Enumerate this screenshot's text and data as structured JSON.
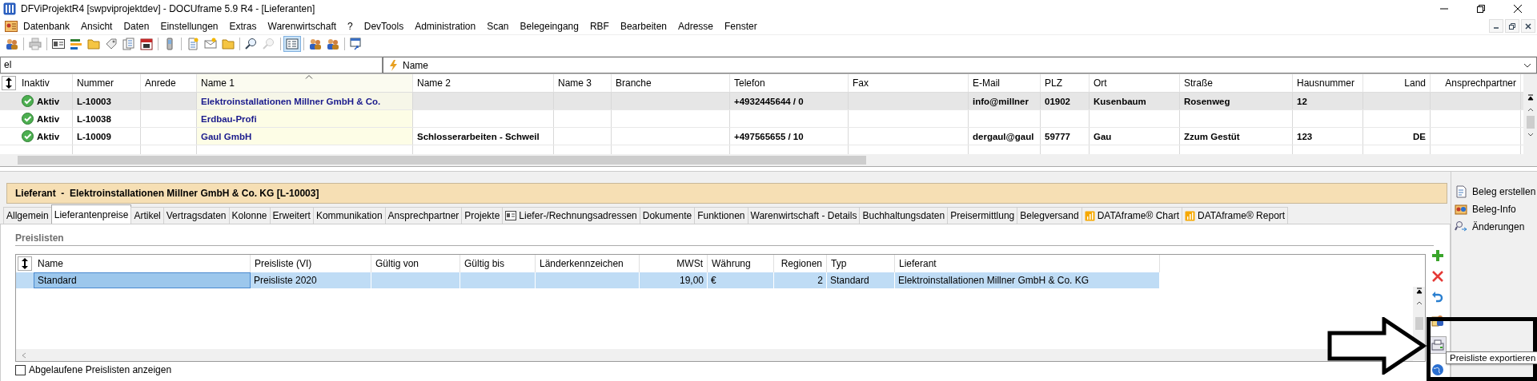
{
  "window": {
    "title": "DFViProjektR4 [swpviprojektdev] - DOCUframe 5.9 R4 - [Lieferanten]"
  },
  "menu": [
    "Datenbank",
    "Ansicht",
    "Daten",
    "Einstellungen",
    "Extras",
    "Warenwirtschaft",
    "?",
    "DevTools",
    "Administration",
    "Scan",
    "Belegeingang",
    "RBF",
    "Bearbeiten",
    "Adresse",
    "Fenster"
  ],
  "filter": {
    "value": "el",
    "field": "Name"
  },
  "grid": {
    "columns": [
      {
        "label": "Inaktiv",
        "sorted": false
      },
      {
        "label": "Nummer",
        "sorted": false
      },
      {
        "label": "Anrede",
        "sorted": false
      },
      {
        "label": "Name 1",
        "sorted": true
      },
      {
        "label": "Name 2",
        "sorted": false
      },
      {
        "label": "Name 3",
        "sorted": false
      },
      {
        "label": "Branche",
        "sorted": false
      },
      {
        "label": "Telefon",
        "sorted": false
      },
      {
        "label": "Fax",
        "sorted": false
      },
      {
        "label": "E-Mail",
        "sorted": false
      },
      {
        "label": "PLZ",
        "sorted": false
      },
      {
        "label": "Ort",
        "sorted": false
      },
      {
        "label": "Straße",
        "sorted": false
      },
      {
        "label": "Hausnummer",
        "sorted": false
      },
      {
        "label": "Land",
        "sorted": false
      },
      {
        "label": "Ansprechpartner",
        "sorted": false
      }
    ],
    "rows": [
      {
        "selected": true,
        "cells": [
          "Aktiv",
          "L-10003",
          "",
          "Elektroinstallationen Millner GmbH & Co.",
          "",
          "",
          "",
          "+4932445644 / 0",
          "",
          "info@millner",
          "01902",
          "Kusenbaum",
          "Rosenweg",
          "12",
          "",
          ""
        ]
      },
      {
        "selected": false,
        "cells": [
          "Aktiv",
          "L-10038",
          "",
          "Erdbau-Profi",
          "",
          "",
          "",
          "",
          "",
          "",
          "",
          "",
          "",
          "",
          "",
          ""
        ]
      },
      {
        "selected": false,
        "cells": [
          "Aktiv",
          "L-10009",
          "",
          "Gaul GmbH",
          "Schlosserarbeiten - Schweil",
          "",
          "",
          "+497565655 / 10",
          "",
          "dergaul@gaul",
          "59777",
          "Gau",
          "Zzum Gestüt",
          "123",
          "DE",
          ""
        ]
      }
    ]
  },
  "detail": {
    "header": "Lieferant  -  Elektroinstallationen Millner GmbH & Co. KG [L-10003]",
    "tabs": [
      {
        "label": "Allgemein",
        "selected": false,
        "kind": "plain"
      },
      {
        "label": "Lieferantenpreise",
        "selected": true,
        "kind": "plain"
      },
      {
        "label": "Artikel",
        "selected": false,
        "kind": "plain"
      },
      {
        "label": "Vertragsdaten",
        "selected": false,
        "kind": "plain"
      },
      {
        "label": "Kolonne",
        "selected": false,
        "kind": "plain"
      },
      {
        "label": "Erweitert",
        "selected": false,
        "kind": "plain"
      },
      {
        "label": "Kommunikation",
        "selected": false,
        "kind": "plain"
      },
      {
        "label": "Ansprechpartner",
        "selected": false,
        "kind": "plain"
      },
      {
        "label": "Projekte",
        "selected": false,
        "kind": "plain"
      },
      {
        "label": "Liefer-/Rechnungsadressen",
        "selected": false,
        "kind": "card"
      },
      {
        "label": "Dokumente",
        "selected": false,
        "kind": "plain"
      },
      {
        "label": "Funktionen",
        "selected": false,
        "kind": "plain"
      },
      {
        "label": "Warenwirtschaft - Details",
        "selected": false,
        "kind": "plain"
      },
      {
        "label": "Buchhaltungsdaten",
        "selected": false,
        "kind": "plain"
      },
      {
        "label": "Preisermittlung",
        "selected": false,
        "kind": "plain"
      },
      {
        "label": "Belegversand",
        "selected": false,
        "kind": "plain"
      },
      {
        "label": "DATAframe® Chart",
        "selected": false,
        "kind": "chart"
      },
      {
        "label": "DATAframe® Report",
        "selected": false,
        "kind": "chart"
      }
    ],
    "section": "Preislisten",
    "price_grid": {
      "columns": [
        "Name",
        "Preisliste (VI)",
        "Gültig von",
        "Gültig bis",
        "Länderkennzeichen",
        "MWSt",
        "Währung",
        "Regionen",
        "Typ",
        "Lieferant"
      ],
      "rows": [
        {
          "selected": true,
          "cells": [
            "Standard",
            "Preisliste 2020",
            "",
            "",
            "",
            "19,00",
            "€",
            "2",
            "Standard",
            "Elektroinstallationen Millner GmbH & Co. KG"
          ]
        }
      ]
    },
    "show_expired": {
      "label": "Abgelaufene Preislisten anzeigen",
      "checked": false
    },
    "tooltip": "Preisliste exportieren"
  },
  "sidebar": [
    "Beleg erstellen",
    "Beleg-Info",
    "Änderungen"
  ]
}
